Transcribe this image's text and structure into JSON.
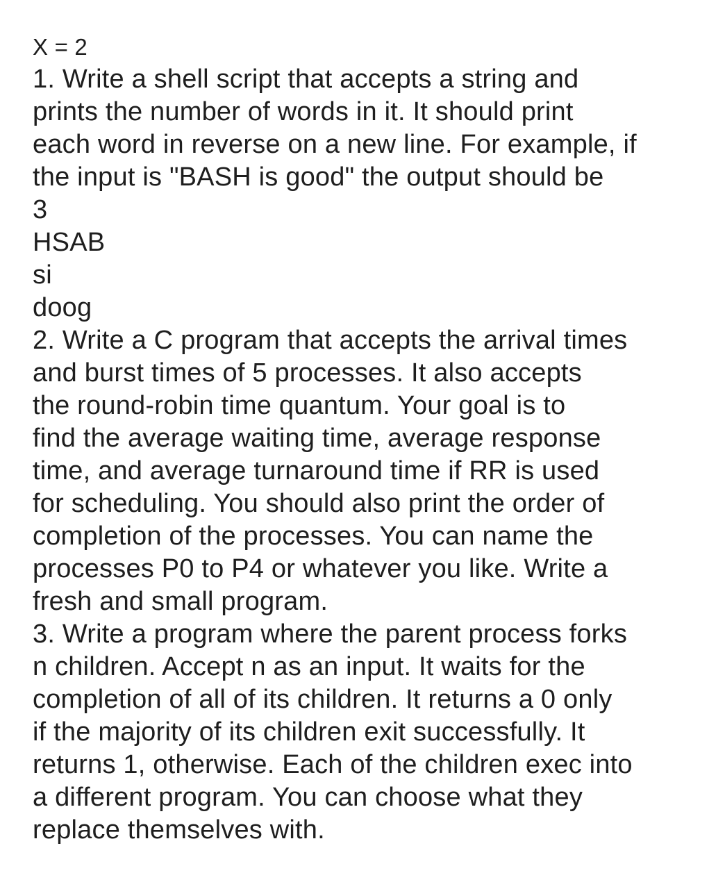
{
  "header": {
    "variable_line": "X = 2"
  },
  "question1": {
    "lines": [
      "1. Write a shell script that accepts a string and",
      "prints the number of words in it. It should print",
      "each word in reverse on a new line. For example, if",
      "the input is \"BASH is good\" the output should be"
    ],
    "example_output": [
      "3",
      "HSAB",
      "si",
      "doog"
    ]
  },
  "question2": {
    "lines": [
      "2. Write a C program that accepts the arrival times",
      "and burst times of 5 processes. It also accepts",
      "the round-robin time quantum. Your goal is to",
      "find the average waiting time, average response",
      "time, and average turnaround time if RR is used",
      "for scheduling. You should also print the order of",
      "completion of the processes. You can name the",
      "processes P0 to P4 or whatever you like. Write a",
      "fresh and small program."
    ]
  },
  "question3": {
    "lines": [
      "3. Write a program where the parent process forks",
      "n children. Accept n as an input. It waits for the",
      "completion of all of its children. It returns a 0 only",
      "if the majority of its children exit successfully. It",
      "returns 1, otherwise. Each of the children exec into",
      "a different program. You can choose what they",
      "replace themselves with."
    ]
  }
}
